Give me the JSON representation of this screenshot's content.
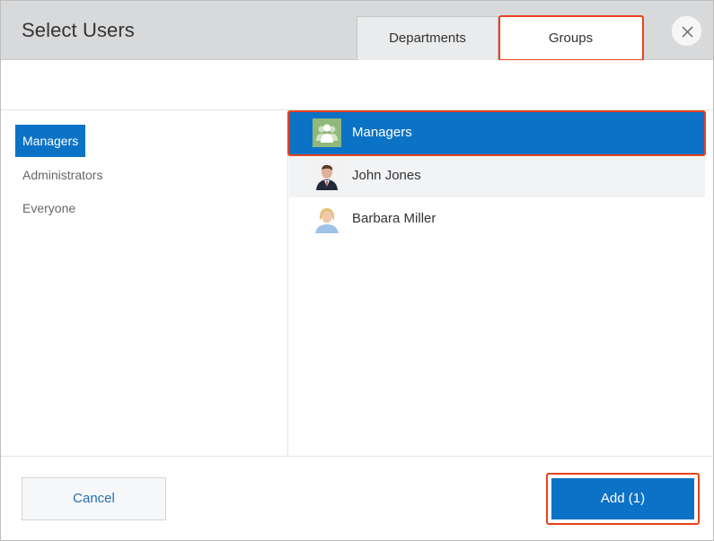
{
  "dialog": {
    "title": "Select Users",
    "close_icon": "close-icon"
  },
  "tabs": [
    {
      "label": "Departments",
      "active": false
    },
    {
      "label": "Groups",
      "active": true
    }
  ],
  "groups": [
    {
      "label": "Managers",
      "active": true
    },
    {
      "label": "Administrators",
      "active": false
    },
    {
      "label": "Everyone",
      "active": false
    }
  ],
  "members": [
    {
      "name": "Managers",
      "avatar": "group-icon",
      "selected": true
    },
    {
      "name": "John Jones",
      "avatar": "man-photo",
      "selected": false
    },
    {
      "name": "Barbara Miller",
      "avatar": "woman-photo",
      "selected": false
    }
  ],
  "footer": {
    "cancel_label": "Cancel",
    "add_label": "Add (1)"
  },
  "colors": {
    "accent": "#0c72c6",
    "highlight": "#e8421c",
    "header_bg": "#d8d9da"
  }
}
